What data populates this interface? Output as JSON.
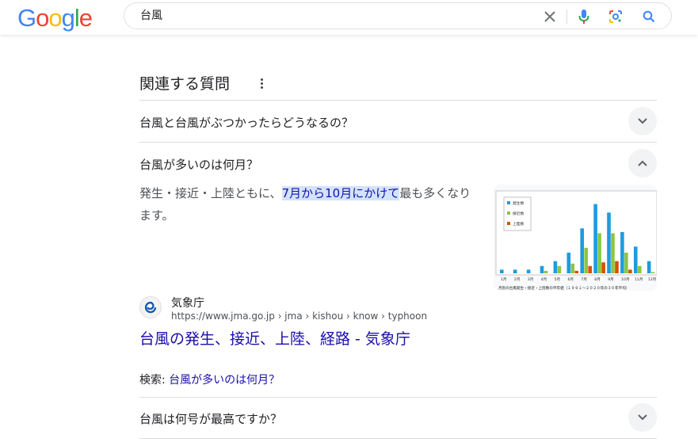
{
  "header": {
    "logo_letters": [
      {
        "ch": "G",
        "color": "#4285F4"
      },
      {
        "ch": "o",
        "color": "#EA4335"
      },
      {
        "ch": "o",
        "color": "#FBBC05"
      },
      {
        "ch": "g",
        "color": "#4285F4"
      },
      {
        "ch": "l",
        "color": "#34A853"
      },
      {
        "ch": "e",
        "color": "#EA4335"
      }
    ],
    "query": "台風",
    "icons": [
      "close-icon",
      "mic-icon",
      "lens-icon",
      "search-icon"
    ]
  },
  "paa": {
    "title": "関連する質問",
    "questions": [
      {
        "text": "台風と台風がぶつかったらどうなるの？",
        "expanded": false
      },
      {
        "text": "台風が多いのは何月？",
        "expanded": true
      },
      {
        "text": "台風は何号が最高ですか？",
        "expanded": false
      }
    ],
    "answer": {
      "before": "発生・接近・上陸ともに、",
      "highlight": "7月から10月にかけて",
      "after": "最も多くなります。"
    },
    "thumbnail": {
      "legend": [
        "発生数",
        "接近数",
        "上陸数"
      ],
      "months": [
        "1月",
        "2月",
        "3月",
        "4月",
        "5月",
        "6月",
        "7月",
        "8月",
        "9月",
        "10月",
        "11月",
        "12月"
      ],
      "caption": "月別の台風発生・接近・上陸数の平年値（１９９１～２０２０年の３０年平均）",
      "series": [
        {
          "name": "発生数",
          "color": "#1e9be0",
          "values": [
            0.3,
            0.3,
            0.3,
            0.6,
            1.0,
            1.7,
            3.7,
            5.7,
            5.0,
            3.4,
            2.2,
            1.0
          ]
        },
        {
          "name": "接近数",
          "color": "#8cc63f",
          "values": [
            0,
            0,
            0,
            0.2,
            0.6,
            0.8,
            2.1,
            3.3,
            3.3,
            1.7,
            0.6,
            0.1
          ]
        },
        {
          "name": "上陸数",
          "color": "#d94f00",
          "values": [
            0,
            0,
            0,
            0,
            0,
            0.2,
            0.6,
            0.9,
            1.0,
            0.3,
            0,
            0
          ]
        }
      ]
    },
    "source": {
      "site_name": "気象庁",
      "url": "https://www.jma.go.jp › jma › kishou › know › typhoon",
      "title": "台風の発生、接近、上陸、経路 - 気象庁"
    },
    "search_label": "検索: ",
    "search_link": "台風が多いのは何月？"
  }
}
